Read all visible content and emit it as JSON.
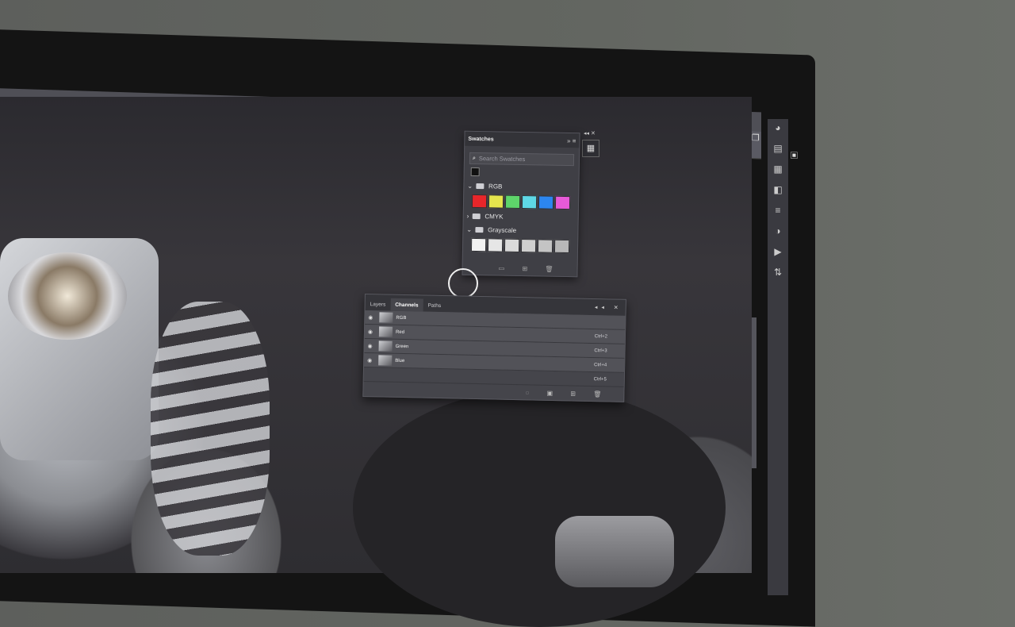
{
  "swatches_panel": {
    "tab": "Swatches",
    "search_placeholder": "Search Swatches",
    "groups": [
      {
        "name": "RGB",
        "expanded": true,
        "colors": [
          "#e8262a",
          "#e6e64d",
          "#5ed56a",
          "#5ed8e6",
          "#2c86f0",
          "#e85ad8"
        ]
      },
      {
        "name": "CMYK",
        "expanded": false
      },
      {
        "name": "Grayscale",
        "expanded": true,
        "colors": [
          "#f2f2f2",
          "#e6e6e6",
          "#dadada",
          "#cfcfcf",
          "#c4c4c4",
          "#b8b8b8"
        ]
      }
    ]
  },
  "channels_panel": {
    "tabs": [
      "Layers",
      "Channels",
      "Paths"
    ],
    "active_tab": "Channels",
    "rows": [
      {
        "name": "RGB",
        "shortcut": ""
      },
      {
        "name": "Red",
        "shortcut": "Ctrl+2"
      },
      {
        "name": "Green",
        "shortcut": "Ctrl+3"
      },
      {
        "name": "Blue",
        "shortcut": "Ctrl+4"
      },
      {
        "name": "",
        "shortcut": "Ctrl+5"
      }
    ]
  },
  "icons": {
    "window_controls": "— ❐ ✕",
    "top_right": "⌕ ▣",
    "side_toolbar": [
      "◕",
      "▤",
      "▦",
      "◧",
      "≡",
      "◑",
      "▶",
      "⇅"
    ],
    "swatches_menu": "» ≡",
    "channels_header": "◂◂ ✕",
    "swatches_footer": "▭ ⊞ 🗑",
    "channels_footer": "◌ ▣ ⊞ 🗑"
  }
}
